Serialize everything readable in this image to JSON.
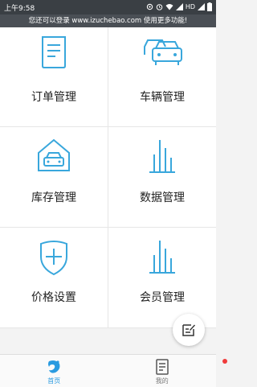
{
  "statusbar": {
    "time": "上午9:58",
    "network": "HD"
  },
  "banner": {
    "text": "您还可以登录 www.izuchebao.com 使用更多功能!"
  },
  "menu": [
    {
      "label": "订单管理",
      "icon": "order-document-icon"
    },
    {
      "label": "车辆管理",
      "icon": "vehicles-icon"
    },
    {
      "label": "库存管理",
      "icon": "garage-car-icon"
    },
    {
      "label": "数据管理",
      "icon": "bar-chart-icon"
    },
    {
      "label": "价格设置",
      "icon": "shield-plus-icon"
    },
    {
      "label": "会员管理",
      "icon": "member-bars-icon"
    }
  ],
  "fab": {
    "icon": "edit-note-icon"
  },
  "tabs": [
    {
      "label": "首页",
      "icon": "home-logo-icon",
      "active": true
    },
    {
      "label": "我的",
      "icon": "profile-document-icon",
      "active": false
    }
  ],
  "colors": {
    "accent": "#2a9be0",
    "icon": "#39a7dc",
    "badge": "#f03a3a"
  }
}
